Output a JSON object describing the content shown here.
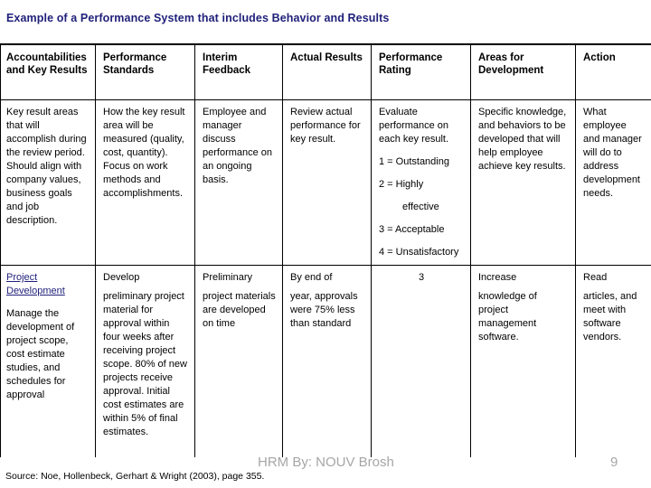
{
  "slide": {
    "title": "Example of a Performance System that includes Behavior and Results",
    "title_color": "#1f1f7a"
  },
  "table": {
    "headers": [
      "Accountabilities and Key Results",
      "Performance Standards",
      "Interim Feedback",
      "Actual Results",
      "Performance Rating",
      "Areas for Development",
      "Action"
    ],
    "rows": [
      {
        "row_type": "description",
        "cells": {
          "accountabilities": "Key result areas that will accomplish during the review period. Should align with company  values, business goals and job description.",
          "standards": "How the key result area will be measured (quality, cost, quantity). Focus on work methods and accomplishments.",
          "feedback": "Employee and manager discuss performance on an ongoing basis.",
          "actual_results": "Review actual performance for key result.",
          "rating_intro": "Evaluate performance on each key result.",
          "rating_scale": [
            "1 = Outstanding",
            "2 = Highly",
            "effective",
            "3 = Acceptable",
            "4 = Unsatisfactory"
          ],
          "areas_for_development": "Specific knowledge, and behaviors to be developed that will help employee achieve key results.",
          "action": "What employee and manager will do to address development needs."
        }
      },
      {
        "row_type": "example",
        "cells": {
          "accountabilities_link": "Project Development",
          "accountabilities": "Manage the development of project scope, cost estimate studies, and schedules for approval",
          "standards_lead": "Develop",
          "standards": "preliminary project material for approval within four weeks after receiving project scope. 80% of new projects receive approval. Initial cost estimates are within 5% of final estimates.",
          "feedback_lead": "Preliminary",
          "feedback": "project materials are developed on time",
          "actual_results_lead": "By end of",
          "actual_results": "year, approvals were 75% less than standard",
          "rating": "3",
          "areas_lead": "Increase",
          "areas_for_development": "knowledge of project management software.",
          "action_lead": "Read",
          "action": "articles, and meet with software vendors."
        }
      }
    ]
  },
  "footer": {
    "watermark": "HRM By: NOUV Brosh",
    "page_number": "9",
    "source": "Source: Noe, Hollenbeck, Gerhart & Wright  (2003), page 355.",
    "watermark_color": "#a6a6a6"
  }
}
